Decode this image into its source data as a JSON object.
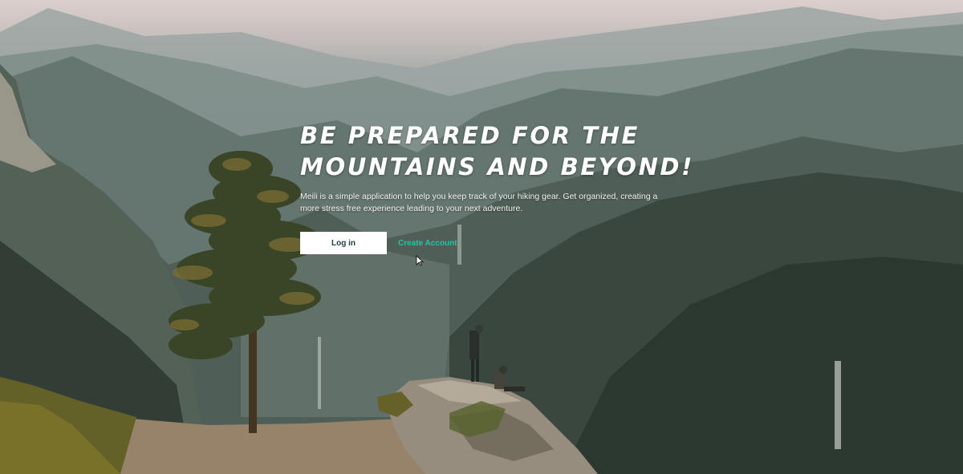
{
  "hero": {
    "headline_line1": "BE PREPARED FOR THE",
    "headline_line2": "MOUNTAINS AND BEYOND!",
    "tagline": "Meili is a simple application to help you keep track of your hiking gear. Get organized, creating a more stress free experience leading to your next adventure.",
    "login_label": "Log in",
    "create_account_label": "Create Account"
  },
  "background": {
    "description_icon": "mountain-landscape-photo",
    "accent_color": "#26c2a6"
  }
}
